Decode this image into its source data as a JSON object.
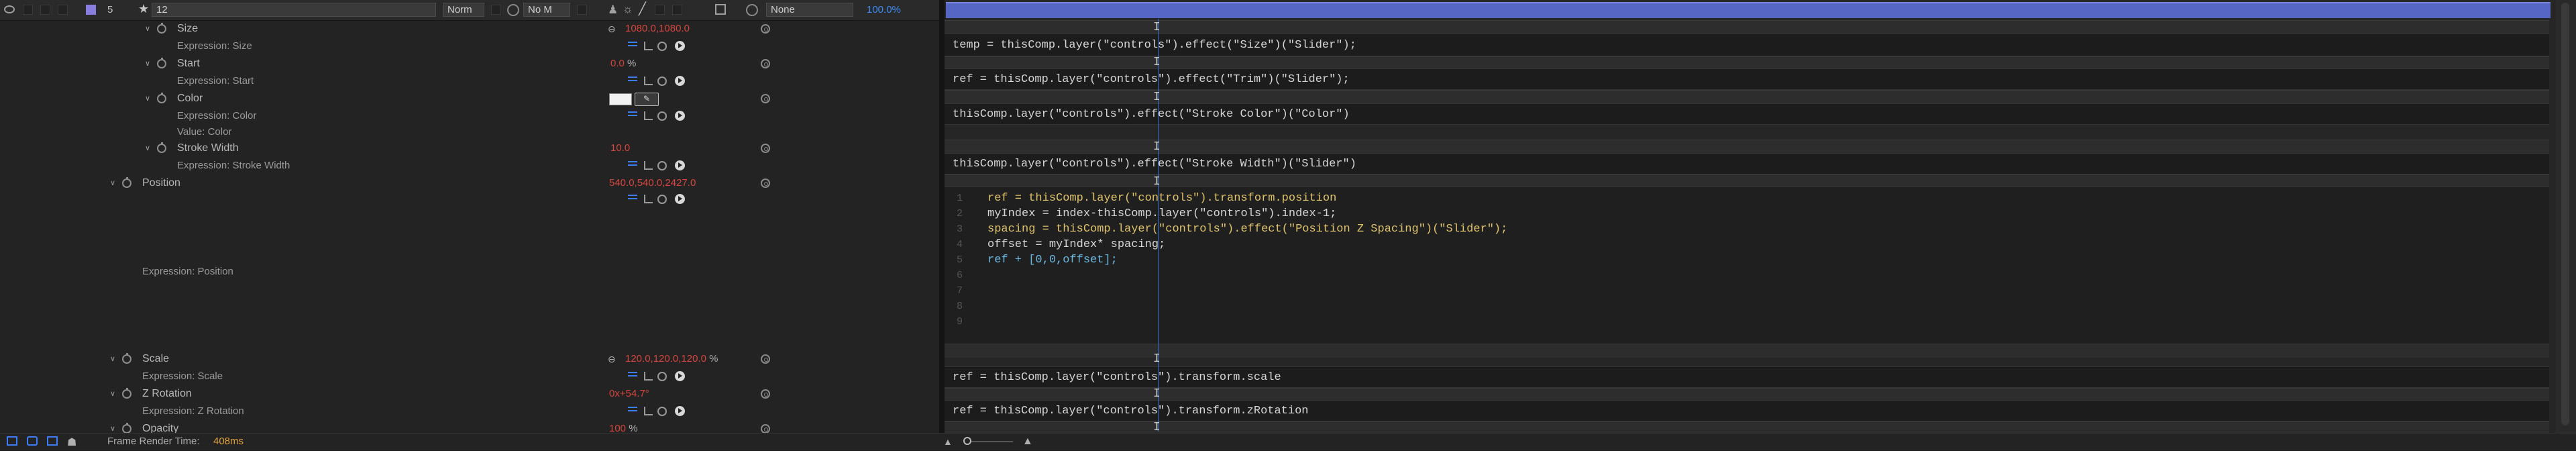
{
  "layer": {
    "number": "5",
    "name": "12",
    "mode": "Norm",
    "trkmat": "No M",
    "parent": "None",
    "stretch": "100.0%"
  },
  "properties": {
    "size": {
      "label": "Size",
      "value": "1080.0,1080.0",
      "expr_label": "Expression: Size"
    },
    "start": {
      "label": "Start",
      "value": "0.0",
      "unit": "%",
      "expr_label": "Expression: Start"
    },
    "color": {
      "label": "Color",
      "expr_label": "Expression: Color",
      "value_label": "Value: Color"
    },
    "stroke_width": {
      "label": "Stroke Width",
      "value": "10.0",
      "expr_label": "Expression: Stroke Width"
    },
    "position": {
      "label": "Position",
      "value": "540.0,540.0,2427.0",
      "expr_label": "Expression: Position"
    },
    "scale": {
      "label": "Scale",
      "value": "120.0,120.0,120.0",
      "unit": "%",
      "expr_label": "Expression: Scale"
    },
    "z_rotation": {
      "label": "Z Rotation",
      "value": "0x+54.7°",
      "expr_label": "Expression: Z Rotation"
    },
    "opacity": {
      "label": "Opacity",
      "value": "100",
      "unit": "%"
    }
  },
  "expressions": {
    "size": "temp = thisComp.layer(\"controls\").effect(\"Size\")(\"Slider\");",
    "start": "ref = thisComp.layer(\"controls\").effect(\"Trim\")(\"Slider\");",
    "color": "thisComp.layer(\"controls\").effect(\"Stroke Color\")(\"Color\")",
    "stroke_width": "thisComp.layer(\"controls\").effect(\"Stroke Width\")(\"Slider\")",
    "scale": "ref = thisComp.layer(\"controls\").transform.scale",
    "z_rotation": "ref = thisComp.layer(\"controls\").transform.zRotation"
  },
  "position_code": {
    "line_numbers": [
      "1",
      "2",
      "3",
      "4",
      "5",
      "6",
      "7",
      "8",
      "9"
    ],
    "lines": [
      "ref = thisComp.layer(\"controls\").transform.position",
      "myIndex = index-thisComp.layer(\"controls\").index-1;",
      "spacing = thisComp.layer(\"controls\").effect(\"Position Z Spacing\")(\"Slider\");",
      "offset = myIndex* spacing;",
      "ref + [0,0,offset];"
    ]
  },
  "status": {
    "frame_render_label": "Frame Render Time:",
    "frame_render_value": "408ms"
  },
  "colors": {
    "value_red": "#d6463e",
    "accent_blue": "#3d7cf5",
    "work_area": "#5566c4",
    "label_color": "#8a7de0"
  }
}
